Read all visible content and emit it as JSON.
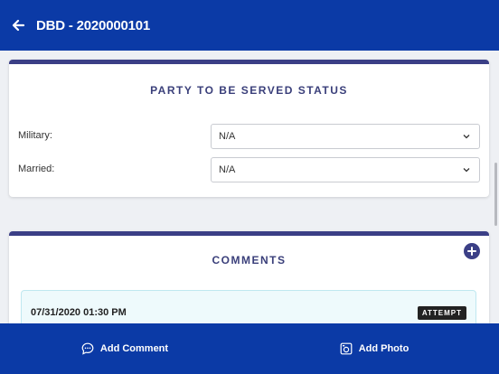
{
  "app": {
    "title": "DBD - 2020000101",
    "back_icon": "arrow-left-icon"
  },
  "party_status": {
    "title": "PARTY TO BE SERVED STATUS",
    "fields": [
      {
        "label": "Military:",
        "value": "N/A"
      },
      {
        "label": "Married:",
        "value": "N/A"
      }
    ]
  },
  "comments": {
    "title": "COMMENTS",
    "add_icon": "plus-circle-icon",
    "items": [
      {
        "datetime": "07/31/2020 01:30 PM",
        "badge": "ATTEMPT"
      }
    ]
  },
  "bottom_bar": {
    "add_comment": {
      "label": "Add Comment",
      "icon": "comment-icon"
    },
    "add_photo": {
      "label": "Add Photo",
      "icon": "camera-icon"
    }
  },
  "colors": {
    "brand_blue": "#0b3aa6",
    "accent_navy": "#3b3f86",
    "badge_dark": "#222222"
  }
}
